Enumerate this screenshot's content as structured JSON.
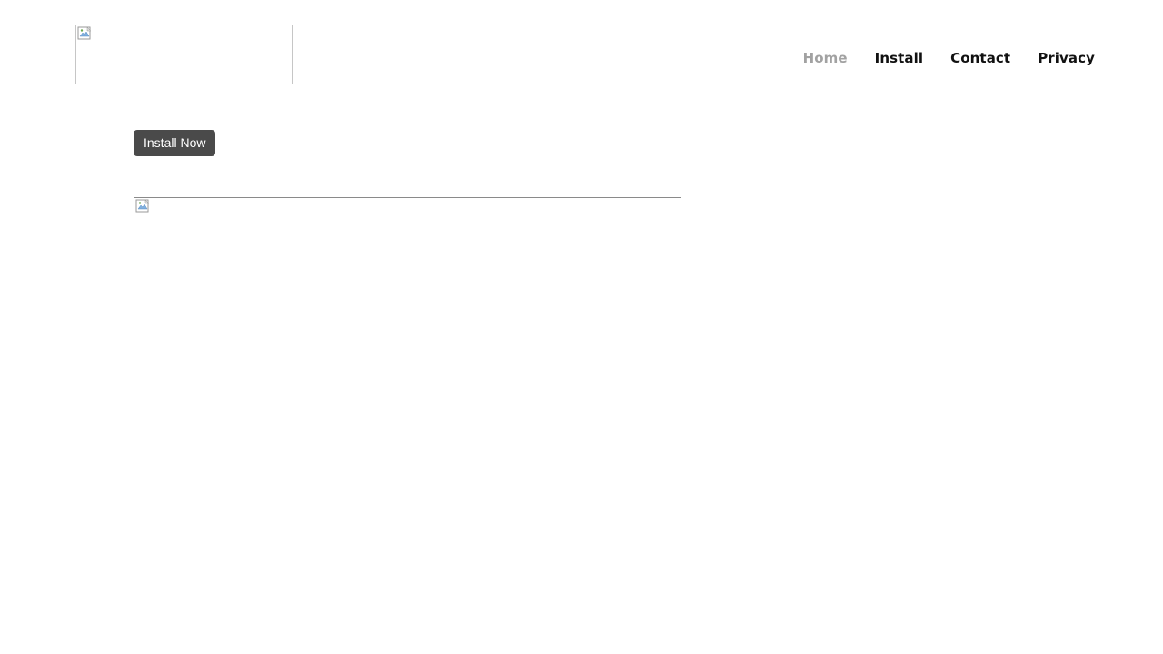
{
  "header": {
    "logo_icon": "broken-image-icon",
    "nav": {
      "items": [
        {
          "label": "Home",
          "active": true
        },
        {
          "label": "Install",
          "active": false
        },
        {
          "label": "Contact",
          "active": false
        },
        {
          "label": "Privacy",
          "active": false
        }
      ]
    }
  },
  "main": {
    "install_button": {
      "label": "Install Now"
    },
    "hero_image_icon": "broken-image-icon"
  },
  "colors": {
    "nav_active": "#a2a2a2",
    "nav_default": "#111111",
    "button_bg": "#4a4a4a",
    "button_text": "#ffffff"
  }
}
